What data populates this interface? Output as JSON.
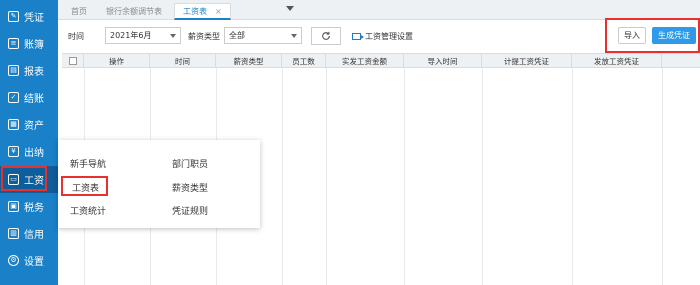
{
  "sidebar": {
    "items": [
      {
        "label": "凭证",
        "icon": "edit-icon"
      },
      {
        "label": "账簿",
        "icon": "book-icon"
      },
      {
        "label": "报表",
        "icon": "report-icon"
      },
      {
        "label": "结账",
        "icon": "checkout-icon"
      },
      {
        "label": "资产",
        "icon": "asset-icon"
      },
      {
        "label": "出纳",
        "icon": "cashier-icon"
      },
      {
        "label": "工资",
        "icon": "payroll-icon"
      },
      {
        "label": "税务",
        "icon": "tax-icon"
      },
      {
        "label": "信用",
        "icon": "credit-icon"
      },
      {
        "label": "设置",
        "icon": "gear-icon"
      }
    ]
  },
  "tabs": {
    "home": "首页",
    "bank": "银行余额调节表",
    "active": "工资表",
    "close": "×"
  },
  "toolbar": {
    "time_label": "时间",
    "time_value": "2021年6月",
    "type_label": "薪资类型",
    "type_value": "全部",
    "wage_setting": "工资管理设置",
    "import": "导入",
    "generate": "生成凭证"
  },
  "table": {
    "headers": [
      "操作",
      "时间",
      "薪资类型",
      "员工数",
      "实发工资金额",
      "导入时间",
      "计提工资凭证",
      "发放工资凭证"
    ]
  },
  "popup": {
    "left": [
      "新手导航",
      "工资表",
      "工资统计"
    ],
    "right": [
      "部门职员",
      "薪资类型",
      "凭证规则"
    ]
  },
  "colors": {
    "sidebar": "#1a80c8",
    "accent": "#2f9ae8",
    "highlight": "#e8302e"
  }
}
